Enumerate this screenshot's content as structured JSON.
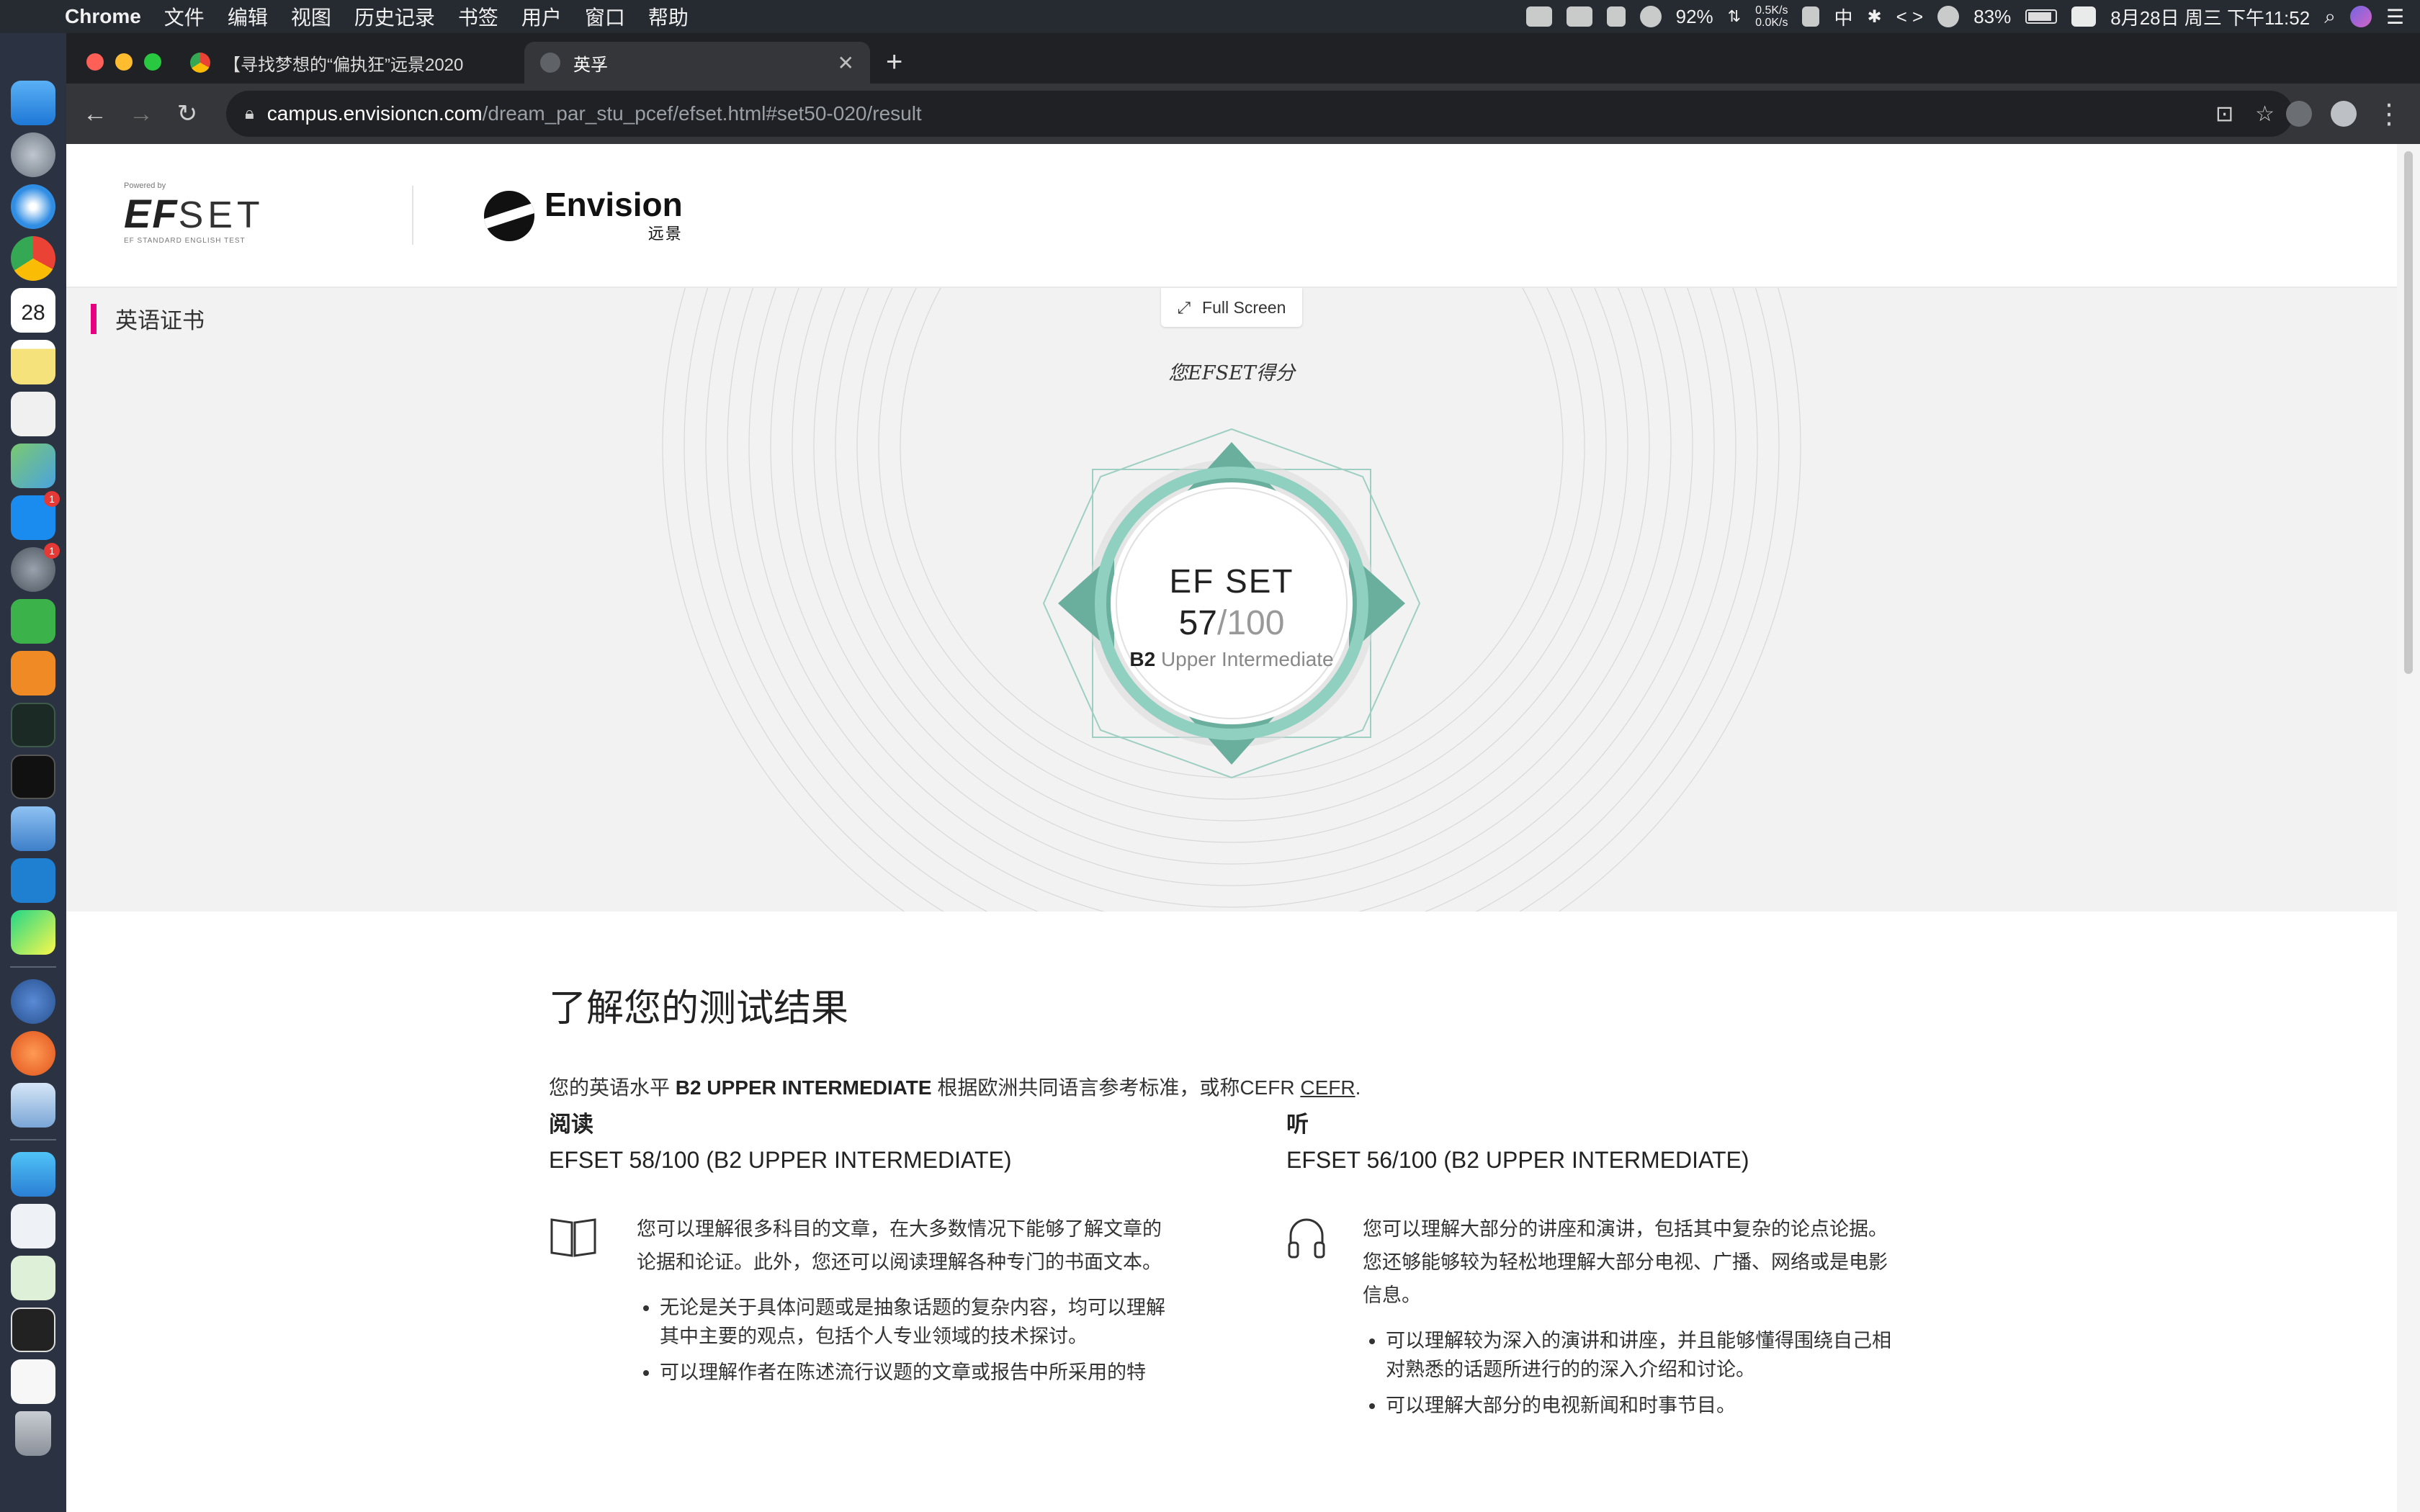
{
  "menubar": {
    "app": "Chrome",
    "items": [
      "文件",
      "编辑",
      "视图",
      "历史记录",
      "书签",
      "用户",
      "窗口",
      "帮助"
    ],
    "battery_1": "92%",
    "net_up": "0.5K/s",
    "net_down": "0.0K/s",
    "input_method": "中",
    "battery_2": "83%",
    "datetime": "8月28日 周三 下午11:52"
  },
  "dock": {
    "apps": [
      "finder",
      "launchpad",
      "safari",
      "chrome",
      "calendar",
      "notes",
      "textedit",
      "maps",
      "app-store",
      "system-preferences",
      "wechat",
      "sublime-text",
      "activity-monitor",
      "terminal",
      "quicktime",
      "vscode",
      "pycharm",
      "xcode-tools",
      "instruments",
      "preview",
      "sourcetree",
      "window-1",
      "window-2",
      "window-3",
      "window-4",
      "trash"
    ],
    "calendar_day": "28",
    "badge": "1"
  },
  "browser": {
    "tabs": [
      {
        "title": "【寻找梦想的“偏执狂”远景2020",
        "active": false
      },
      {
        "title": "英孚",
        "active": true
      }
    ],
    "url_host": "campus.envisioncn.com",
    "url_path": "/dream_par_stu_pcef/efset.html#set50-020/result"
  },
  "page": {
    "logo_efset": {
      "powered": "Powered by",
      "ef": "EF",
      "set": "SET",
      "tagline": "EF STANDARD ENGLISH TEST"
    },
    "logo_envision": {
      "en": "Envision",
      "cn": "远景"
    },
    "cert_label": "英语证书",
    "fullscreen_label": "Full Screen",
    "score_caption": "您EFSET得分",
    "emblem": {
      "title": "EF SET",
      "score": "57",
      "max": "/100",
      "level_code": "B2",
      "level_name": "Upper Intermediate"
    },
    "results": {
      "heading": "了解您的测试结果",
      "intro_prefix": "您的英语水平",
      "intro_level": "B2 UPPER INTERMEDIATE",
      "intro_suffix": "根据欧洲共同语言参考标准，或称CEFR",
      "intro_link": "CEFR",
      "reading": {
        "name": "阅读",
        "score": "EFSET 58/100 (B2 UPPER INTERMEDIATE)",
        "desc": "您可以理解很多科目的文章，在大多数情况下能够了解文章的论据和论证。此外，您还可以阅读理解各种专门的书面文本。",
        "bullets": [
          "无论是关于具体问题或是抽象话题的复杂内容，均可以理解其中主要的观点，包括个人专业领域的技术探讨。",
          "可以理解作者在陈述流行议题的文章或报告中所采用的特"
        ]
      },
      "listening": {
        "name": "听",
        "score": "EFSET 56/100 (B2 UPPER INTERMEDIATE)",
        "desc": "您可以理解大部分的讲座和演讲，包括其中复杂的论点论据。您还够能够较为轻松地理解大部分电视、广播、网络或是电影信息。",
        "bullets": [
          "可以理解较为深入的演讲和讲座，并且能够懂得围绕自己相对熟悉的话题所进行的的深入介绍和讨论。",
          "可以理解大部分的电视新闻和时事节目。"
        ]
      }
    }
  },
  "colors": {
    "accent": "#e6007e",
    "emblem": "#6aaf9d"
  }
}
